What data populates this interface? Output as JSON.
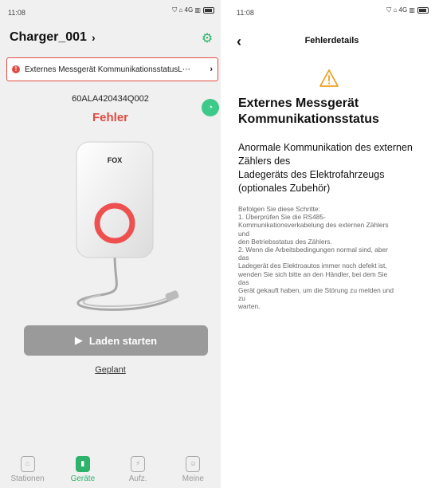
{
  "left": {
    "statusbar": {
      "time": "11:08",
      "icons": "⛉ ⌂ 4G ▥"
    },
    "header": {
      "title": "Charger_001",
      "chevron": "›",
      "gear_icon": "⚙"
    },
    "alert": {
      "icon": "!",
      "text": "Externes Messgerät KommunikationsstatusL⋯",
      "arrow": "›"
    },
    "device": {
      "serial": "60ALA420434Q002",
      "status": "Fehler",
      "brand": "FOX",
      "wifi_icon": "◔"
    },
    "actions": {
      "start_icon": "▶",
      "start_label": "Laden starten",
      "planned_label": "Geplant"
    },
    "tabs": [
      {
        "label": "Stationen",
        "icon": "⌂"
      },
      {
        "label": "Geräte",
        "icon": "▮"
      },
      {
        "label": "Aufz.",
        "icon": "⚡"
      },
      {
        "label": "Meine",
        "icon": "☺"
      }
    ],
    "colors": {
      "accent": "#2db36b",
      "error": "#e24a43",
      "button_disabled": "#9a9a9a"
    }
  },
  "right": {
    "statusbar": {
      "time": "11:08",
      "icons": "⛉ ⌂ 4G ▥"
    },
    "header": {
      "back_icon": "‹",
      "title": "Fehlerdetails"
    },
    "error": {
      "title": "Externes Messgerät Kommunikationsstatus",
      "subtitle_lines": [
        "Anormale Kommunikation des externen Zählers des",
        "Ladegeräts des Elektrofahrzeugs",
        "(optionales Zubehör)"
      ],
      "steps_lines": [
        "Befolgen Sie diese Schritte:",
        "1. Überprüfen Sie die RS485-",
        "Kommunikationsverkabelung des externen Zählers",
        "und",
        "den Betriebsstatus des Zählers.",
        "2. Wenn die Arbeitsbedingungen normal sind, aber",
        "das",
        "Ladegerät des Elektroautos immer noch defekt ist,",
        "wenden Sie sich bitte an den Händler, bei dem Sie",
        "das",
        "Gerät gekauft haben, um die Störung zu melden und",
        "zu",
        "warten."
      ]
    },
    "colors": {
      "warning": "#f0a020"
    }
  }
}
